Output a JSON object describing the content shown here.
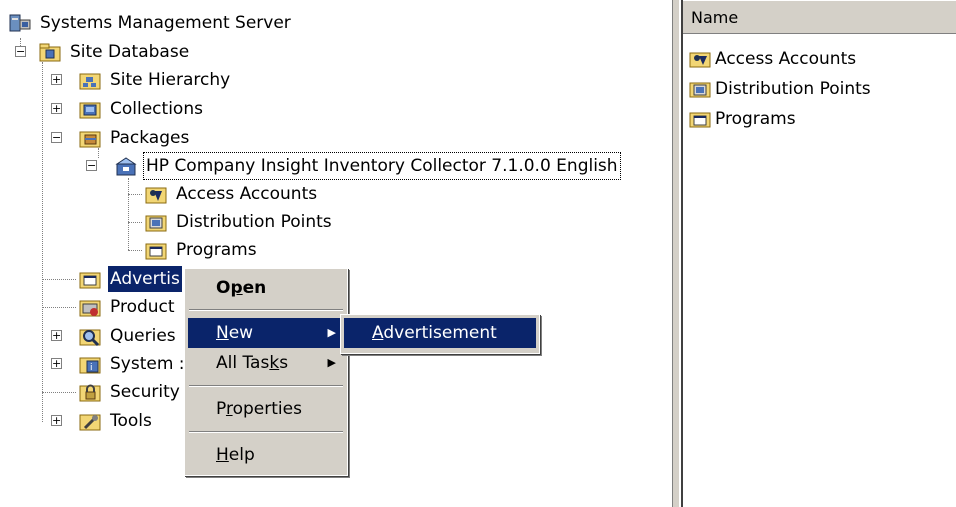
{
  "tree": {
    "root": "Systems Management Server",
    "site_database": "Site Database",
    "site_hierarchy": "Site Hierarchy",
    "collections": "Collections",
    "packages": "Packages",
    "package_name": "HP Company Insight Inventory Collector 7.1.0.0 English",
    "access_accounts": "Access Accounts",
    "distribution_points": "Distribution Points",
    "programs": "Programs",
    "advertisements": "Advertis",
    "product": "Product",
    "queries": "Queries",
    "system": "System :",
    "security": "Security",
    "tools": "Tools"
  },
  "context_menu": {
    "open_pre": "O",
    "open_u": "p",
    "open_post": "en",
    "new_u": "N",
    "new_post": "ew",
    "alltasks_pre": "All Tas",
    "alltasks_u": "k",
    "alltasks_post": "s",
    "properties_pre": "P",
    "properties_u": "r",
    "properties_post": "operties",
    "help_u": "H",
    "help_post": "elp"
  },
  "submenu": {
    "adv_u": "A",
    "adv_post": "dvertisement"
  },
  "list_pane": {
    "column_header": "Name",
    "items": [
      "Access Accounts",
      "Distribution Points",
      "Programs"
    ]
  },
  "icons": [
    "computer-icon",
    "database-icon",
    "hierarchy-icon",
    "collections-icon",
    "package-icon",
    "package-open-icon",
    "key-folder-icon",
    "distribution-icon",
    "folder-icon",
    "advert-folder-icon",
    "product-icon",
    "queries-icon",
    "system-icon",
    "security-icon",
    "tools-icon"
  ]
}
